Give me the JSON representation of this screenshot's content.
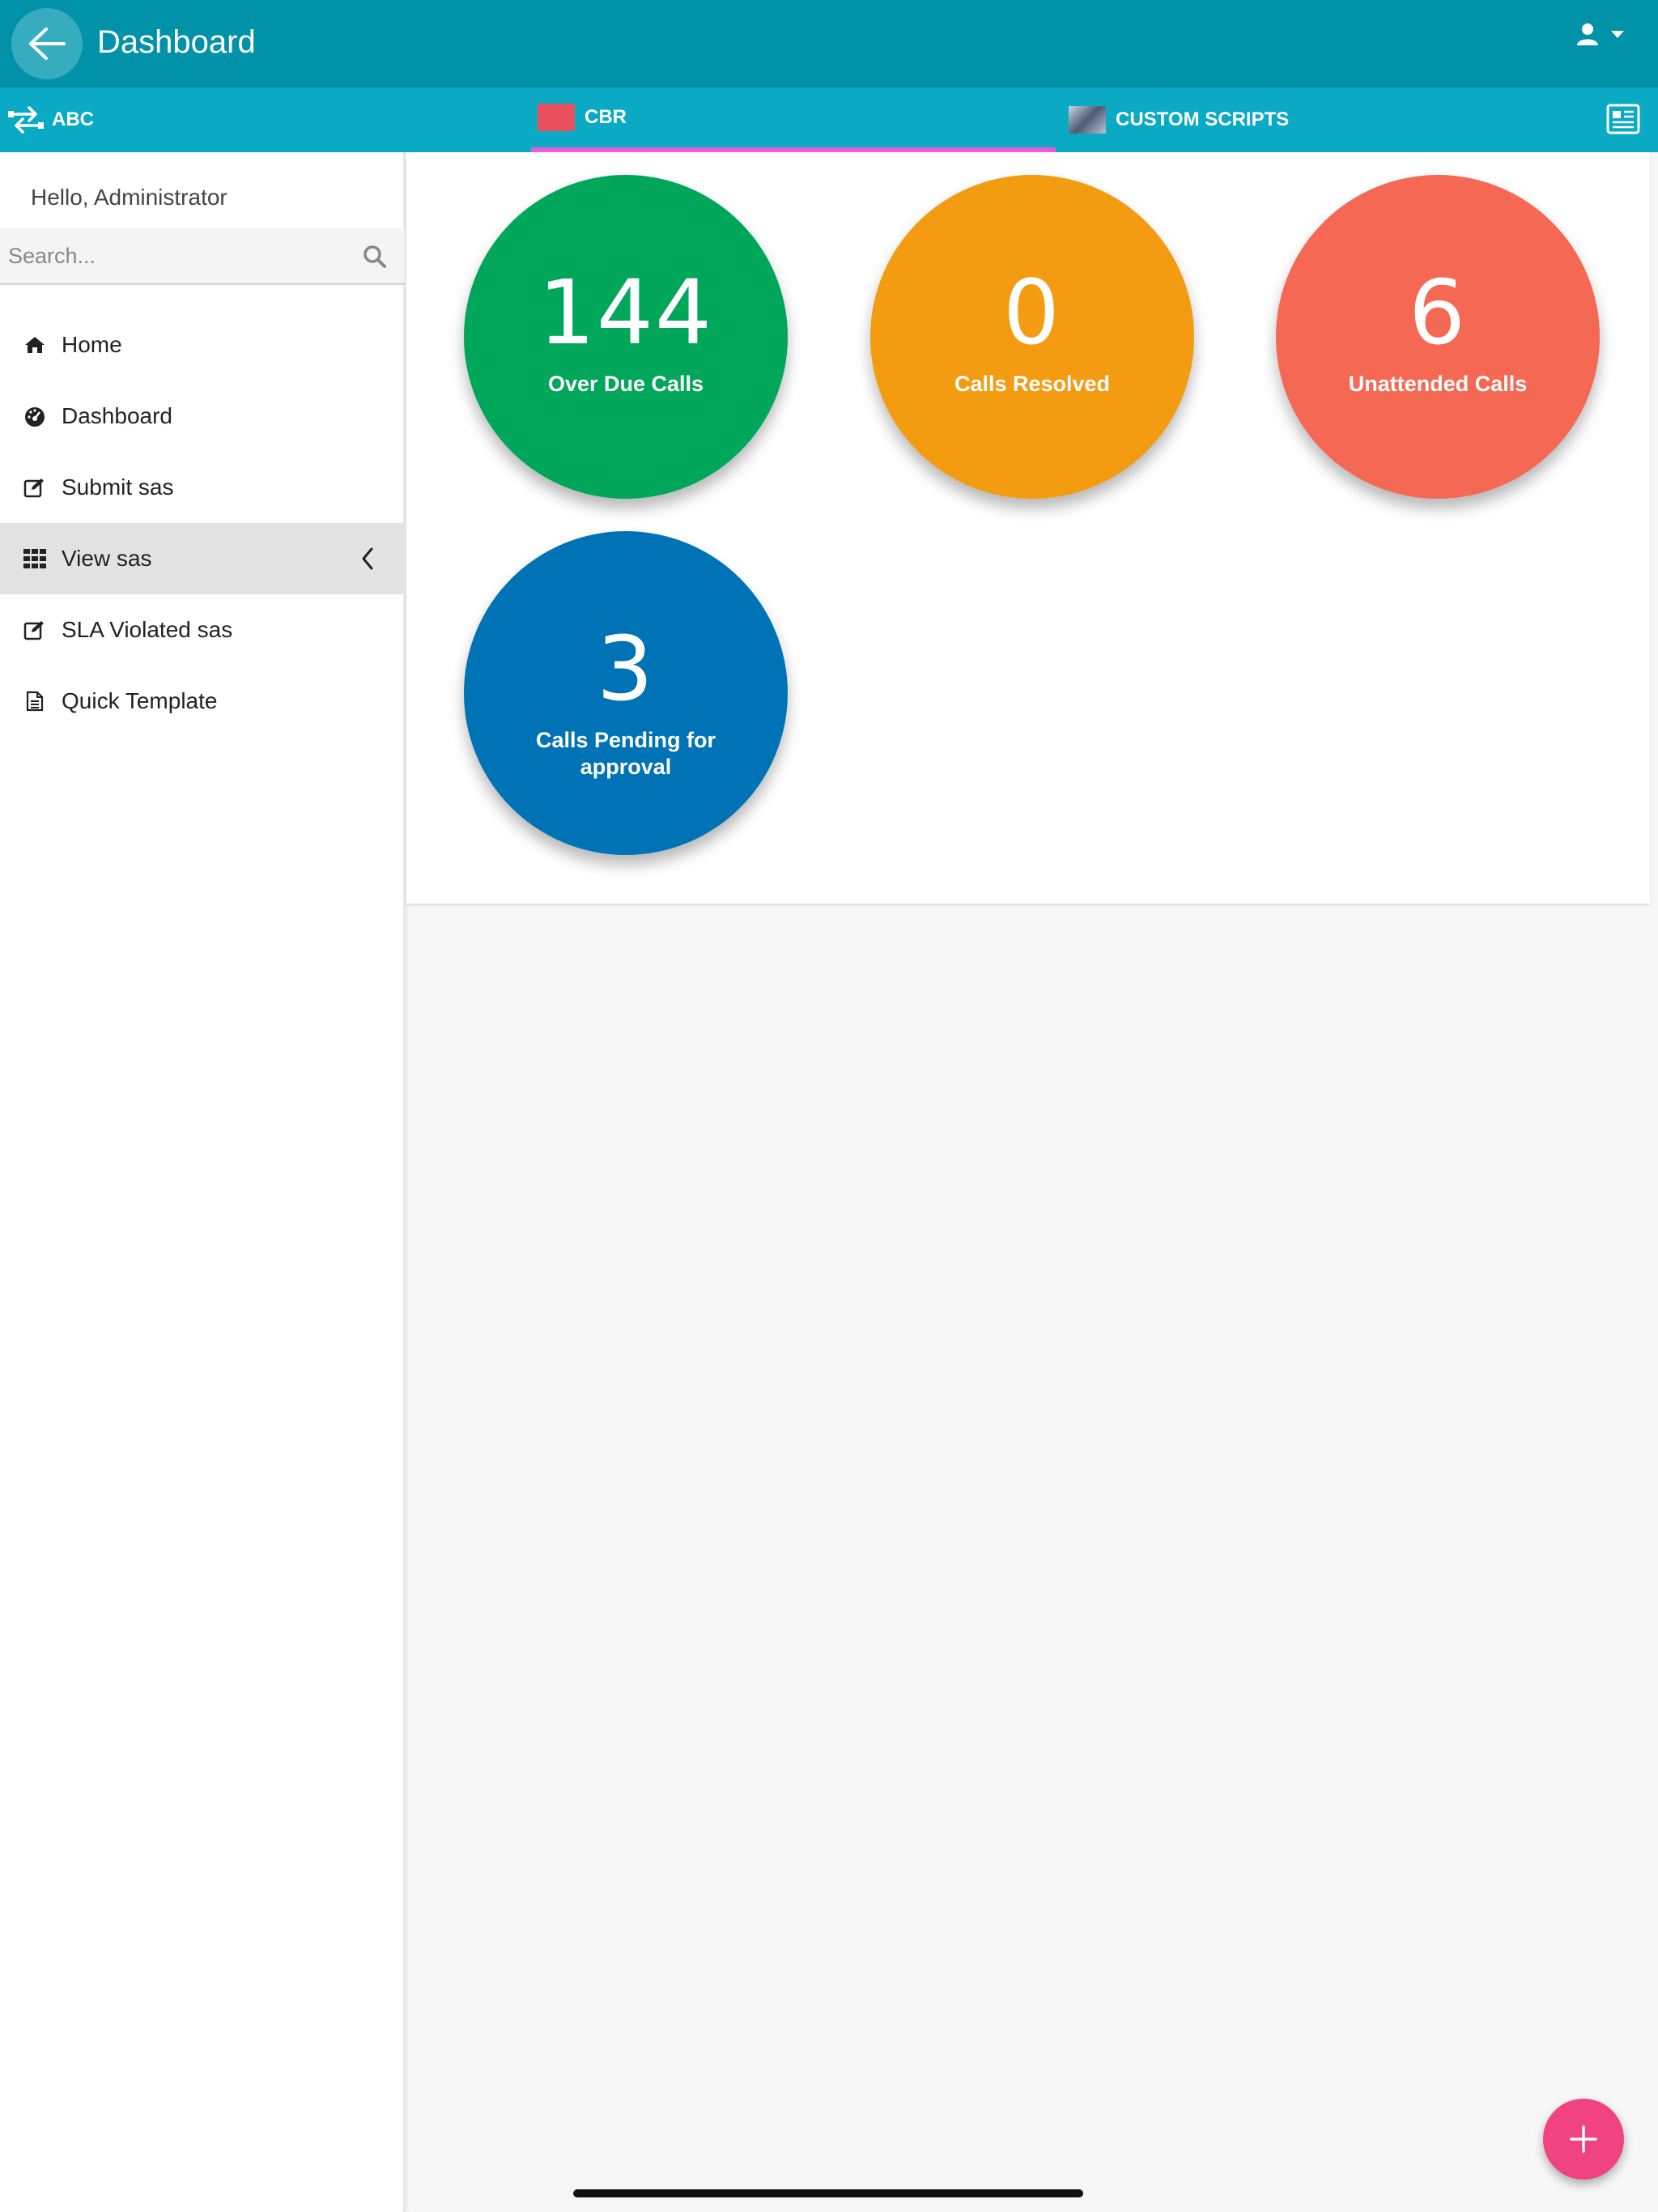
{
  "header": {
    "title": "Dashboard",
    "back_icon": "arrow-left-icon",
    "user_icon": "user-icon"
  },
  "tabs": [
    {
      "label": "ABC",
      "icon": "transfer-arrows-icon"
    },
    {
      "label": "CBR",
      "icon": "cbr-thumbnail",
      "active": true
    },
    {
      "label": "CUSTOM SCRIPTS",
      "icon": "custom-scripts-thumbnail"
    }
  ],
  "sidebar": {
    "greeting": "Hello, Administrator",
    "search": {
      "placeholder": "Search...",
      "value": ""
    },
    "items": [
      {
        "label": "Home",
        "icon": "home-icon"
      },
      {
        "label": "Dashboard",
        "icon": "dashboard-gauge-icon"
      },
      {
        "label": "Submit sas",
        "icon": "edit-icon"
      },
      {
        "label": "View sas",
        "icon": "grid-icon",
        "active": true
      },
      {
        "label": "SLA Violated sas",
        "icon": "edit-icon"
      },
      {
        "label": "Quick Template",
        "icon": "document-icon"
      }
    ]
  },
  "stats": [
    {
      "value": "144",
      "label": "Over Due Calls",
      "color": "#00a65a"
    },
    {
      "value": "0",
      "label": "Calls Resolved",
      "color": "#f39c12"
    },
    {
      "value": "6",
      "label": "Unattended Calls",
      "color": "#f56954"
    },
    {
      "value": "3",
      "label": "Calls Pending for approval",
      "color": "#0073b7"
    }
  ],
  "colors": {
    "appbar": "#0092a8",
    "tabbar": "#0aaac4",
    "tab_indicator": "#e95cd2",
    "fab": "#f0437f"
  }
}
